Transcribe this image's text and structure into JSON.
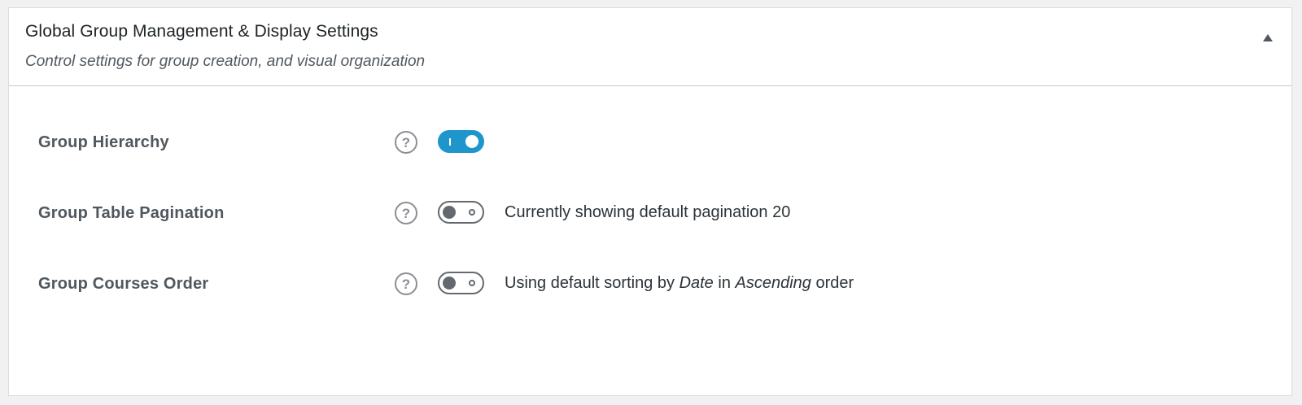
{
  "panel": {
    "title": "Global Group Management & Display Settings",
    "subtitle": "Control settings for group creation, and visual organization",
    "collapse_icon": "triangle-up-icon"
  },
  "settings": [
    {
      "label": "Group Hierarchy",
      "toggle_state": "on",
      "help_icon": "question-circle-icon"
    },
    {
      "label": "Group Table Pagination",
      "toggle_state": "off",
      "help_icon": "question-circle-icon",
      "description": "Currently showing default pagination 20"
    },
    {
      "label": "Group Courses Order",
      "toggle_state": "off",
      "help_icon": "question-circle-icon",
      "description_prefix": "Using default sorting by ",
      "description_orderby": "Date",
      "description_mid": " in ",
      "description_order": "Ascending",
      "description_suffix": " order"
    }
  ],
  "colors": {
    "toggle_on": "#1e96cc",
    "toggle_off": "#646970",
    "label": "#50575e"
  }
}
